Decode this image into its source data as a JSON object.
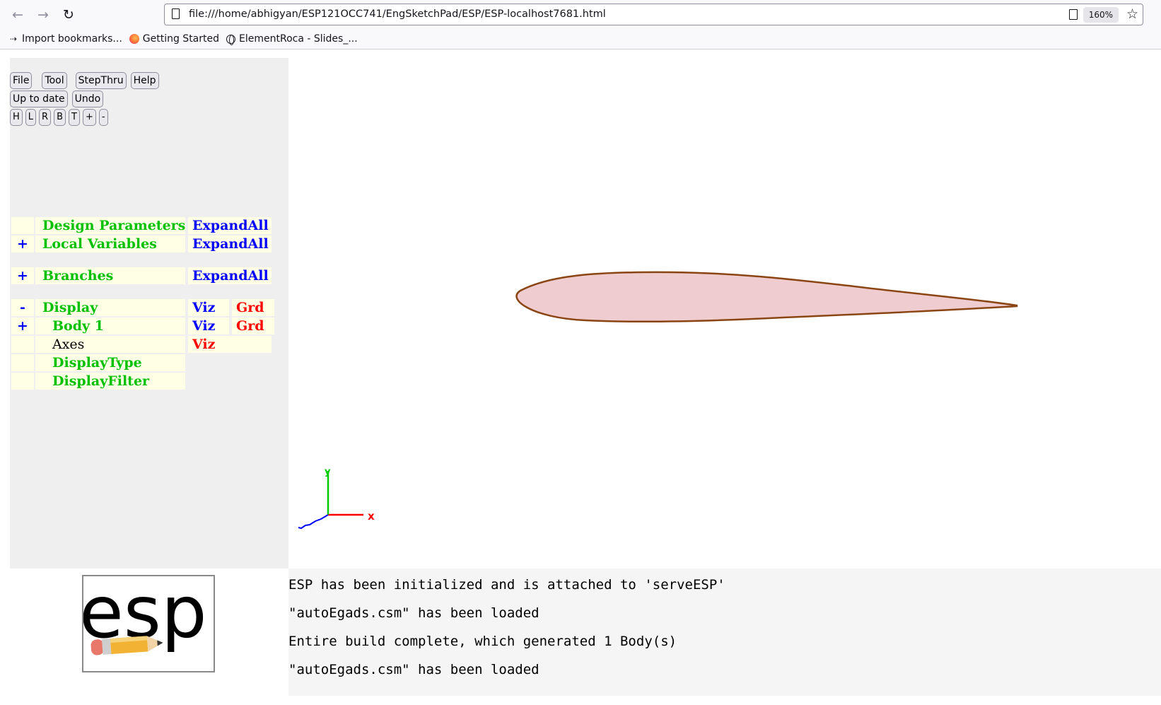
{
  "browser": {
    "url": "file:///home/abhigyan/ESP121OCC741/EngSketchPad/ESP/ESP-localhost7681.html",
    "zoom": "160%",
    "bookmarks": [
      {
        "label": "Import bookmarks...",
        "icon": "import-icon"
      },
      {
        "label": "Getting Started",
        "icon": "firefox-icon"
      },
      {
        "label": "ElementRoca - Slides_...",
        "icon": "globe-icon"
      }
    ]
  },
  "toolbar": {
    "file": "File",
    "tool": "Tool",
    "stepthru": "StepThru",
    "help": "Help",
    "uptodate": "Up to date",
    "undo": "Undo",
    "views": [
      "H",
      "L",
      "R",
      "B",
      "T",
      "+",
      "-"
    ]
  },
  "tree": {
    "design_parameters": {
      "expander": "",
      "label": "Design Parameters",
      "action": "ExpandAll"
    },
    "local_variables": {
      "expander": "+",
      "label": "Local Variables",
      "action": "ExpandAll"
    },
    "branches": {
      "expander": "+",
      "label": "Branches",
      "action": "ExpandAll"
    },
    "display": {
      "expander": "-",
      "label": "Display",
      "viz": "Viz",
      "grd": "Grd"
    },
    "body1": {
      "expander": "+",
      "label": "Body 1",
      "viz": "Viz",
      "grd": "Grd"
    },
    "axes": {
      "label": "Axes",
      "viz": "Viz"
    },
    "display_type": {
      "label": "DisplayType"
    },
    "display_filter": {
      "label": "DisplayFilter"
    }
  },
  "graphics": {
    "airfoil_fill": "#efcccf",
    "airfoil_edge": "#8b4513",
    "axis_x_label": "x",
    "axis_y_label": "y",
    "axis_colors": {
      "x": "#ff0000",
      "y": "#00cc00",
      "z": "#0000ff"
    }
  },
  "logo": {
    "text": "esp"
  },
  "messages": [
    "ESP has been initialized and is attached to 'serveESP'",
    "\"autoEgads.csm\" has been loaded",
    "Entire build complete, which generated 1 Body(s)",
    "\"autoEgads.csm\" has been loaded"
  ]
}
